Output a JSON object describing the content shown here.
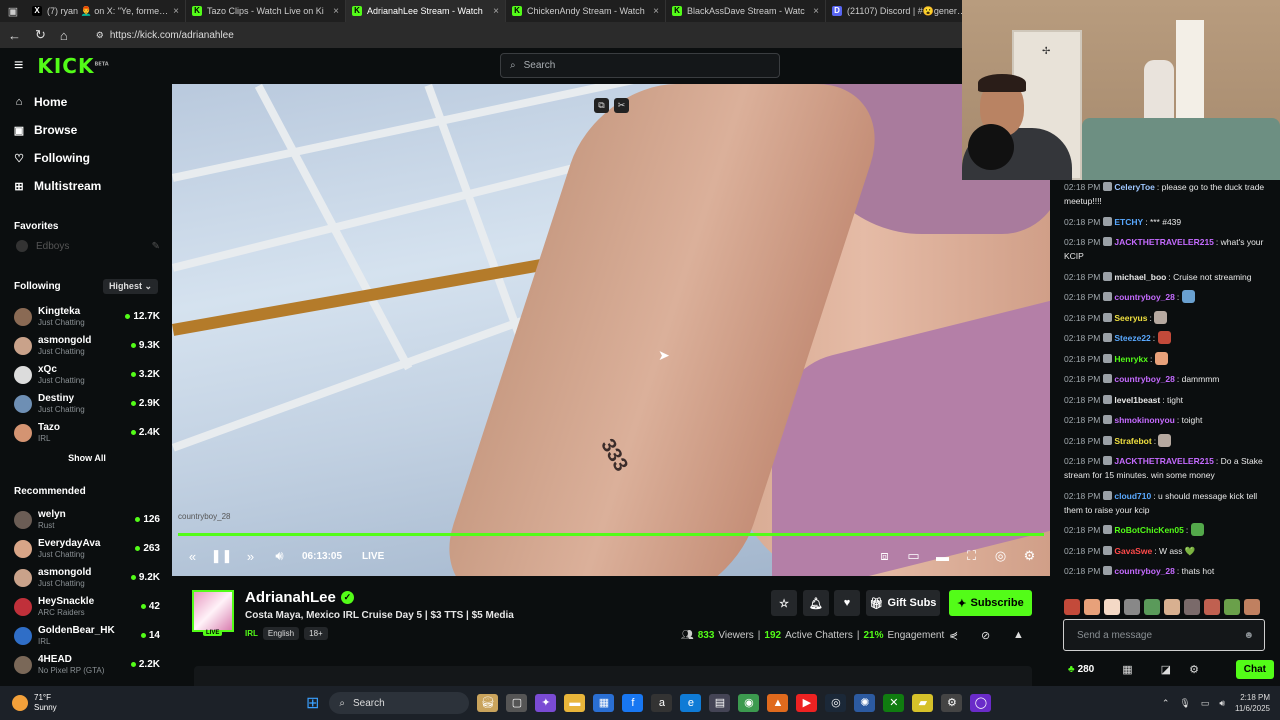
{
  "browser": {
    "tabs": [
      {
        "title": "(7) ryan 👨‍🦰 on X: \"Ye, formerly kn",
        "favicon": "X",
        "color": "#000000"
      },
      {
        "title": "Tazo Clips - Watch Live on Ki",
        "favicon": "K",
        "color": "#53fc18"
      },
      {
        "title": "AdrianahLee Stream - Watch",
        "favicon": "K",
        "color": "#53fc18"
      },
      {
        "title": "ChickenAndy Stream - Watch",
        "favicon": "K",
        "color": "#53fc18"
      },
      {
        "title": "BlackAssDave Stream - Watc",
        "favicon": "K",
        "color": "#53fc18"
      },
      {
        "title": "(21107) Discord | #😮general | F",
        "favicon": "D",
        "color": "#5865f2"
      }
    ],
    "url": "https://kick.com/adrianahlee"
  },
  "kick": {
    "logo": "KICK",
    "logo_badge": "BETA",
    "search_placeholder": "Search"
  },
  "sidebar": {
    "nav": [
      {
        "label": "Home",
        "icon": "home-icon"
      },
      {
        "label": "Browse",
        "icon": "browse-icon"
      },
      {
        "label": "Following",
        "icon": "heart-icon"
      },
      {
        "label": "Multistream",
        "icon": "grid-icon"
      }
    ],
    "favorites_title": "Favorites",
    "favorites": [
      {
        "name": "Edboys"
      }
    ],
    "following_title": "Following",
    "sort_label": "Highest",
    "following": [
      {
        "name": "Kingteka",
        "category": "Just Chatting",
        "viewers": "12.7K",
        "color": "#8a6a54"
      },
      {
        "name": "asmongold",
        "category": "Just Chatting",
        "viewers": "9.3K",
        "color": "#c9a28a"
      },
      {
        "name": "xQc",
        "category": "Just Chatting",
        "viewers": "3.2K",
        "color": "#dcdcdc"
      },
      {
        "name": "Destiny",
        "category": "Just Chatting",
        "viewers": "2.9K",
        "color": "#6e8fb4"
      },
      {
        "name": "Tazo",
        "category": "IRL",
        "viewers": "2.4K",
        "color": "#d49472"
      }
    ],
    "show_all": "Show All",
    "recommended_title": "Recommended",
    "recommended": [
      {
        "name": "welyn",
        "category": "Rust",
        "viewers": "126",
        "color": "#6b5d55"
      },
      {
        "name": "EverydayAva",
        "category": "Just Chatting",
        "viewers": "263",
        "color": "#d8a587"
      },
      {
        "name": "asmongold",
        "category": "Just Chatting",
        "viewers": "9.2K",
        "color": "#c9a28a"
      },
      {
        "name": "HeySnackle",
        "category": "ARC Raiders",
        "viewers": "42",
        "color": "#c0303a"
      },
      {
        "name": "GoldenBear_HK",
        "category": "IRL",
        "viewers": "14",
        "color": "#2f6ec7"
      },
      {
        "name": "4HEAD",
        "category": "No Pixel RP (GTA)",
        "viewers": "2.2K",
        "color": "#7a6858"
      }
    ]
  },
  "player": {
    "time": "06:13:05",
    "live_label": "LIVE",
    "watermark": "countryboy_28",
    "progress": 1.0
  },
  "stream": {
    "name": "AdrianahLee",
    "live_badge": "LIVE",
    "title": "Costa Maya, Mexico IRL Cruise Day 5 | $3 TTS | $5 Media",
    "category": "IRL",
    "tags": [
      "English",
      "18+"
    ],
    "gift_subs": "Gift Subs",
    "subscribe": "Subscribe",
    "viewers": "833",
    "viewers_label": "Viewers",
    "chatters": "192",
    "chatters_label": "Active Chatters",
    "engagement": "21%",
    "engagement_label": "Engagement"
  },
  "chat": {
    "messages": [
      {
        "time": "02:18 PM",
        "user": "CeleryToe",
        "color": "#9ec6ff",
        "text": "please go to the duck trade meetup!!!!"
      },
      {
        "time": "02:18 PM",
        "user": "ETCHY",
        "color": "#5aa9ff",
        "text": "*** #439"
      },
      {
        "time": "02:18 PM",
        "user": "JACKTHETRAVELER215",
        "color": "#c56bff",
        "text": "what's your KCIP"
      },
      {
        "time": "02:18 PM",
        "user": "michael_boo",
        "color": "#e8e8e8",
        "text": "Cruise not streaming"
      },
      {
        "time": "02:18 PM",
        "user": "countryboy_28",
        "color": "#c56bff",
        "text": ""
      },
      {
        "time": "02:18 PM",
        "user": "Seeryus",
        "color": "#f0e040",
        "text": ""
      },
      {
        "time": "02:18 PM",
        "user": "Steeze22",
        "color": "#5aa9ff",
        "text": ""
      },
      {
        "time": "02:18 PM",
        "user": "Henrykx",
        "color": "#53fc18",
        "text": ""
      },
      {
        "time": "02:18 PM",
        "user": "countryboy_28",
        "color": "#c56bff",
        "text": "dammmm"
      },
      {
        "time": "02:18 PM",
        "user": "level1beast",
        "color": "#e8e8e8",
        "text": "tight"
      },
      {
        "time": "02:18 PM",
        "user": "shmokinonyou",
        "color": "#c56bff",
        "text": "toight"
      },
      {
        "time": "02:18 PM",
        "user": "Strafebot",
        "color": "#f0e040",
        "text": ""
      },
      {
        "time": "02:18 PM",
        "user": "JACKTHETRAVELER215",
        "color": "#c56bff",
        "text": "Do a Stake stream for 15 minutes. win some money"
      },
      {
        "time": "02:18 PM",
        "user": "cloud710",
        "color": "#5aa9ff",
        "text": "u should message kick tell them to raise your kcip"
      },
      {
        "time": "02:18 PM",
        "user": "RoBotChicKen05",
        "color": "#53fc18",
        "text": ""
      },
      {
        "time": "02:18 PM",
        "user": "GavaSwe",
        "color": "#ff4a4a",
        "text": "W ass 💚"
      },
      {
        "time": "02:18 PM",
        "user": "countryboy_28",
        "color": "#c56bff",
        "text": "thats hot"
      }
    ],
    "input_placeholder": "Send a message",
    "kicks": "280",
    "chat_button": "Chat"
  },
  "taskbar": {
    "temperature": "71°F",
    "condition": "Sunny",
    "search": "Search",
    "time": "2:18 PM",
    "date": "11/6/2025"
  }
}
